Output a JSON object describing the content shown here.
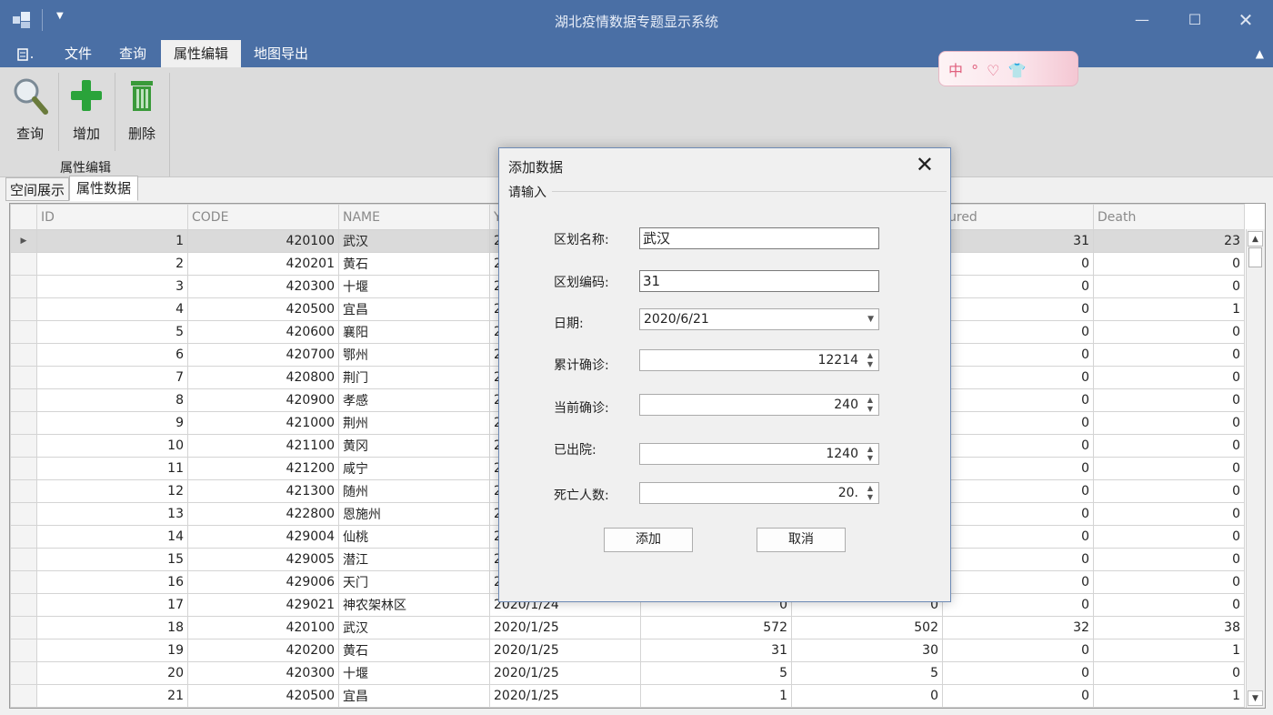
{
  "app": {
    "title": "湖北疫情数据专题显示系统"
  },
  "menu": {
    "items": [
      {
        "label": "文件"
      },
      {
        "label": "查询"
      },
      {
        "label": "属性编辑"
      },
      {
        "label": "地图导出"
      }
    ]
  },
  "ribbon": {
    "buttons": [
      {
        "label": "查询",
        "icon": "search-icon"
      },
      {
        "label": "增加",
        "icon": "plus-icon"
      },
      {
        "label": "删除",
        "icon": "trash-icon"
      }
    ],
    "group_label": "属性编辑"
  },
  "ime": {
    "text": "中 ° ♡ 👕 "
  },
  "doc_tabs": [
    {
      "label": "空间展示"
    },
    {
      "label": "属性数据"
    }
  ],
  "grid": {
    "columns": [
      "ID",
      "CODE",
      "NAME",
      "Y",
      "",
      "",
      "ured",
      "Death"
    ],
    "rows": [
      [
        "1",
        "420100",
        "武汉",
        "2",
        "",
        "",
        "31",
        "23"
      ],
      [
        "2",
        "420201",
        "黄石",
        "2",
        "",
        "",
        "0",
        "0"
      ],
      [
        "3",
        "420300",
        "十堰",
        "2",
        "",
        "",
        "0",
        "0"
      ],
      [
        "4",
        "420500",
        "宜昌",
        "2",
        "",
        "",
        "0",
        "1"
      ],
      [
        "5",
        "420600",
        "襄阳",
        "2",
        "",
        "",
        "0",
        "0"
      ],
      [
        "6",
        "420700",
        "鄂州",
        "2",
        "",
        "",
        "0",
        "0"
      ],
      [
        "7",
        "420800",
        "荆门",
        "2",
        "",
        "",
        "0",
        "0"
      ],
      [
        "8",
        "420900",
        "孝感",
        "2",
        "",
        "",
        "0",
        "0"
      ],
      [
        "9",
        "421000",
        "荆州",
        "2",
        "",
        "",
        "0",
        "0"
      ],
      [
        "10",
        "421100",
        "黄冈",
        "2",
        "",
        "",
        "0",
        "0"
      ],
      [
        "11",
        "421200",
        "咸宁",
        "2",
        "",
        "",
        "0",
        "0"
      ],
      [
        "12",
        "421300",
        "随州",
        "2",
        "",
        "",
        "0",
        "0"
      ],
      [
        "13",
        "422800",
        "恩施州",
        "2",
        "",
        "",
        "0",
        "0"
      ],
      [
        "14",
        "429004",
        "仙桃",
        "2",
        "",
        "",
        "0",
        "0"
      ],
      [
        "15",
        "429005",
        "潜江",
        "2",
        "",
        "",
        "0",
        "0"
      ],
      [
        "16",
        "429006",
        "天门",
        "2",
        "",
        "",
        "0",
        "0"
      ],
      [
        "17",
        "429021",
        "神农架林区",
        "2020/1/24",
        "0",
        "0",
        "0",
        "0"
      ],
      [
        "18",
        "420100",
        "武汉",
        "2020/1/25",
        "572",
        "502",
        "32",
        "38"
      ],
      [
        "19",
        "420200",
        "黄石",
        "2020/1/25",
        "31",
        "30",
        "0",
        "1"
      ],
      [
        "20",
        "420300",
        "十堰",
        "2020/1/25",
        "5",
        "5",
        "0",
        "0"
      ],
      [
        "21",
        "420500",
        "宜昌",
        "2020/1/25",
        "1",
        "0",
        "0",
        "1"
      ]
    ]
  },
  "dialog": {
    "title": "添加数据",
    "prompt": "请输入",
    "fields": {
      "name": {
        "label": "区划名称:",
        "value": "武汉"
      },
      "code": {
        "label": "区划编码:",
        "value": "31"
      },
      "date": {
        "label": "日期:",
        "value": "2020/6/21"
      },
      "total": {
        "label": "累计确诊:",
        "value": "12214"
      },
      "current": {
        "label": "当前确诊:",
        "value": "240"
      },
      "cured": {
        "label": "已出院:",
        "value": "1240"
      },
      "death": {
        "label": "死亡人数:",
        "value": "20."
      }
    },
    "add_label": "添加",
    "cancel_label": "取消"
  }
}
